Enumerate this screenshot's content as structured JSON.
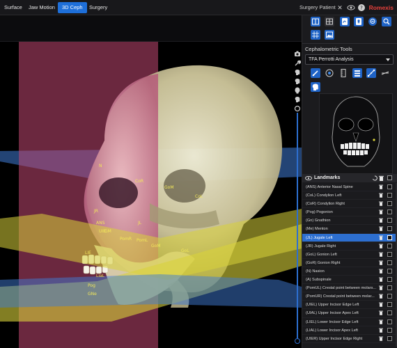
{
  "top_bar": {
    "tabs": [
      {
        "label": "Surface",
        "active": false
      },
      {
        "label": "Jaw Motion",
        "active": false
      },
      {
        "label": "3D Ceph",
        "active": true
      },
      {
        "label": "Surgery",
        "active": false
      }
    ],
    "patient_name": "Surgery Patient",
    "icons": [
      "close-icon",
      "eye-icon",
      "help-icon"
    ],
    "brand": "Romexis",
    "brand_color": "#e8413c",
    "accent_color": "#1e6fd9"
  },
  "viewport": {
    "landmark_labels": [
      "N",
      "CoR",
      "GoM",
      "CoL",
      "JR",
      "ANS",
      "JL",
      "UIE",
      "PomR",
      "PomL",
      "GoM",
      "GoL",
      "LIE",
      "Pog",
      "GNe",
      "GM",
      "LiaL"
    ],
    "plane_colors": {
      "sagittal": "#c24873",
      "frankfort": "#3f7bd6",
      "occlusal": "#d9d23a"
    },
    "side_tools": [
      "camera-icon",
      "wrench-icon",
      "head-profile-icon",
      "head-rotate-icon",
      "head-front-icon",
      "head-side-icon",
      "reset-icon"
    ]
  },
  "panel": {
    "toolbar_icons": [
      "layout-single-icon",
      "layout-quad-icon",
      "ceph-view-icon",
      "tooth-icon",
      "zoom-out-icon",
      "zoom-in-icon",
      "grid-icon",
      "image-icon"
    ],
    "section_title": "Cephalometric Tools",
    "analysis_select": {
      "value": "TFA Perrotti Analysis"
    },
    "tools": [
      "landmark-pen-icon",
      "target-icon",
      "ruler-icon",
      "layers-icon",
      "measure-icon",
      "hide-icon"
    ],
    "head_icon": "head-profile-small-icon",
    "landmarks_header": "Landmarks",
    "landmarks": [
      {
        "label": "(ANS) Anterior Nasal Spine",
        "selected": false
      },
      {
        "label": "(CoL) Condylion Left",
        "selected": false
      },
      {
        "label": "(CoR) Condylion Right",
        "selected": false
      },
      {
        "label": "(Pog) Pogonion",
        "selected": false
      },
      {
        "label": "(Gn) Gnathion",
        "selected": false
      },
      {
        "label": "(Me) Menton",
        "selected": false
      },
      {
        "label": "(JL) Jugale Left",
        "selected": true
      },
      {
        "label": "(JR) Jugale Right",
        "selected": false
      },
      {
        "label": "(GoL) Gonion Left",
        "selected": false
      },
      {
        "label": "(GoR) Gonion Right",
        "selected": false
      },
      {
        "label": "(N) Nasion",
        "selected": false
      },
      {
        "label": "(A) Subspinale",
        "selected": false
      },
      {
        "label": "(PomUL) Crestal point between molars...",
        "selected": false
      },
      {
        "label": "(PomUR) Crestal point between molar...",
        "selected": false
      },
      {
        "label": "(UIEL) Upper Incisor Edge Left",
        "selected": false
      },
      {
        "label": "(UIAL) Upper Incisor Apex Left",
        "selected": false
      },
      {
        "label": "(LIEL) Lower Incisor Edge Left",
        "selected": false
      },
      {
        "label": "(LIAL) Lower Incisor Apex Left",
        "selected": false
      },
      {
        "label": "(UIER) Upper Incisor Edge Right",
        "selected": false
      }
    ]
  }
}
